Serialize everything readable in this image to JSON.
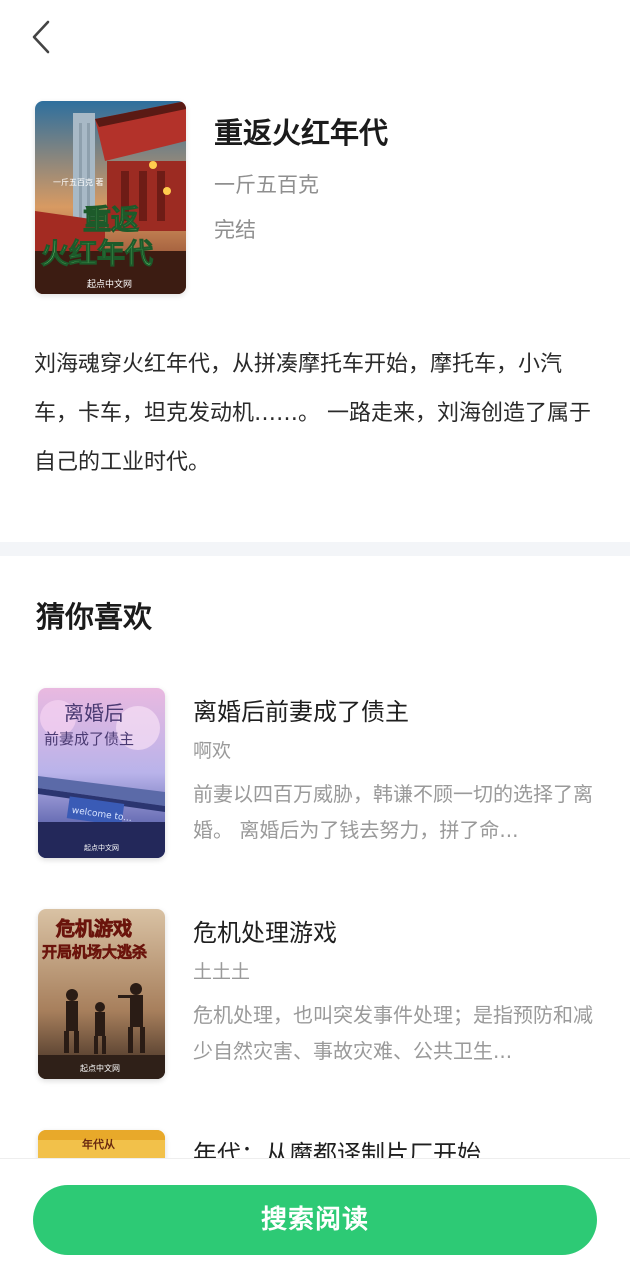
{
  "book": {
    "title": "重返火红年代",
    "author": "一斤五百克",
    "status": "完结",
    "synopsis": "刘海魂穿火红年代，从拼凑摩托车开始，摩托车，小汽车，卡车，坦克发动机……。 一路走来，刘海创造了属于自己的工业时代。",
    "cover": {
      "title_line1": "重返",
      "title_line2": "火红年代",
      "publisher": "起点中文网"
    }
  },
  "recommend": {
    "section_title": "猜你喜欢",
    "items": [
      {
        "title": "离婚后前妻成了债主",
        "author": "啊欢",
        "desc": "前妻以四百万威胁，韩谦不顾一切的选择了离婚。 离婚后为了钱去努力，拼了命...",
        "cover_line1": "离婚后",
        "cover_line2": "前妻成了债主",
        "cover_sign": "welcome to...",
        "cover_publisher": "起点中文网"
      },
      {
        "title": "危机处理游戏",
        "author": "土土土",
        "desc": "危机处理，也叫突发事件处理；是指预防和减少自然灾害、事故灾难、公共卫生...",
        "cover_line1": "危机游戏",
        "cover_line2": "开局机场大逃杀",
        "cover_publisher": "起点中文网"
      },
      {
        "title": "年代：从魔都译制片厂开始",
        "author": "",
        "desc": "",
        "cover_line1": "年代从"
      }
    ]
  },
  "actions": {
    "read_label": "搜索阅读"
  },
  "colors": {
    "accent": "#2dca75",
    "divider": "#f3f5f8",
    "muted_text": "#9a9a9a"
  },
  "icons": {
    "back": "chevron-left-icon"
  }
}
